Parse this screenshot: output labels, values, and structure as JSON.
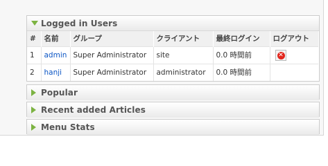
{
  "panels": {
    "logged_in": {
      "title": "Logged in Users",
      "columns": [
        "#",
        "名前",
        "グループ",
        "クライアント",
        "最終ログイン",
        "ログアウト"
      ],
      "rows": [
        {
          "num": "1",
          "name": "admin",
          "group": "Super Administrator",
          "client": "site",
          "last": "0.0 時間前",
          "logout": true
        },
        {
          "num": "2",
          "name": "hanji",
          "group": "Super Administrator",
          "client": "administrator",
          "last": "0.0 時間前",
          "logout": false
        }
      ]
    },
    "popular": {
      "title": "Popular"
    },
    "recent": {
      "title": "Recent added Articles"
    },
    "menu_stats": {
      "title": "Menu Stats"
    }
  },
  "icons": {
    "expanded": "triangle-down-icon",
    "collapsed": "triangle-right-icon",
    "logout": "remove-circle-icon"
  },
  "colors": {
    "arrow": "#7cb342",
    "link": "#0b55c4",
    "logout_icon": "#e2261c"
  }
}
